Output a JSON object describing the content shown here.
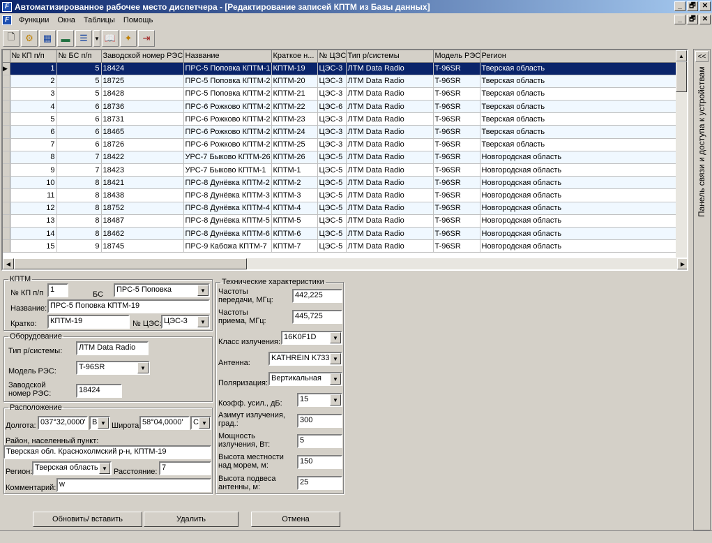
{
  "window": {
    "title": "Автоматизированное рабочее место диспетчера - [Редактирование записей КПТМ из Базы данных]",
    "icon": "app-icon"
  },
  "menu": [
    "Функции",
    "Окна",
    "Таблицы",
    "Помощь"
  ],
  "grid": {
    "columns": [
      "№ КП п/п",
      "№ БС п/п",
      "Заводской номер РЭС",
      "Название",
      "Краткое н...",
      "№ ЦЭС",
      "Тип р/системы",
      "Модель РЭС",
      "Регион"
    ],
    "rows": [
      [
        "1",
        "5",
        "18424",
        "ПРС-5 Поповка КПТМ-1",
        "КПТМ-19",
        "ЦЭС-3",
        "ЛТМ Data Radio",
        "T-96SR",
        "Тверская область"
      ],
      [
        "2",
        "5",
        "18725",
        "ПРС-5 Поповка КПТМ-2",
        "КПТМ-20",
        "ЦЭС-3",
        "ЛТМ Data Radio",
        "T-96SR",
        "Тверская область"
      ],
      [
        "3",
        "5",
        "18428",
        "ПРС-5 Поповка КПТМ-2",
        "КПТМ-21",
        "ЦЭС-3",
        "ЛТМ Data Radio",
        "T-96SR",
        "Тверская область"
      ],
      [
        "4",
        "6",
        "18736",
        "ПРС-6 Рожково КПТМ-2",
        "КПТМ-22",
        "ЦЭС-6",
        "ЛТМ Data Radio",
        "T-96SR",
        "Тверская область"
      ],
      [
        "5",
        "6",
        "18731",
        "ПРС-6 Рожково КПТМ-2",
        "КПТМ-23",
        "ЦЭС-3",
        "ЛТМ Data Radio",
        "T-96SR",
        "Тверская область"
      ],
      [
        "6",
        "6",
        "18465",
        "ПРС-6 Рожково КПТМ-2",
        "КПТМ-24",
        "ЦЭС-3",
        "ЛТМ Data Radio",
        "T-96SR",
        "Тверская область"
      ],
      [
        "7",
        "6",
        "18726",
        "ПРС-6 Рожково КПТМ-2",
        "КПТМ-25",
        "ЦЭС-3",
        "ЛТМ Data Radio",
        "T-96SR",
        "Тверская область"
      ],
      [
        "8",
        "7",
        "18422",
        "УРС-7 Быково КПТМ-26",
        "КПТМ-26",
        "ЦЭС-5",
        "ЛТМ Data Radio",
        "T-96SR",
        "Новгородская область"
      ],
      [
        "9",
        "7",
        "18423",
        "УРС-7 Быково КПТМ-1",
        "КПТМ-1",
        "ЦЭС-5",
        "ЛТМ Data Radio",
        "T-96SR",
        "Новгородская область"
      ],
      [
        "10",
        "8",
        "18421",
        "ПРС-8 Дунёвка КПТМ-2",
        "КПТМ-2",
        "ЦЭС-5",
        "ЛТМ Data Radio",
        "T-96SR",
        "Новгородская область"
      ],
      [
        "11",
        "8",
        "18438",
        "ПРС-8 Дунёвка КПТМ-3",
        "КПТМ-3",
        "ЦЭС-5",
        "ЛТМ Data Radio",
        "T-96SR",
        "Новгородская область"
      ],
      [
        "12",
        "8",
        "18752",
        "ПРС-8 Дунёвка КПТМ-4",
        "КПТМ-4",
        "ЦЭС-5",
        "ЛТМ Data Radio",
        "T-96SR",
        "Новгородская область"
      ],
      [
        "13",
        "8",
        "18487",
        "ПРС-8 Дунёвка КПТМ-5",
        "КПТМ-5",
        "ЦЭС-5",
        "ЛТМ Data Radio",
        "T-96SR",
        "Новгородская область"
      ],
      [
        "14",
        "8",
        "18462",
        "ПРС-8 Дунёвка КПТМ-6",
        "КПТМ-6",
        "ЦЭС-5",
        "ЛТМ Data Radio",
        "T-96SR",
        "Новгородская область"
      ],
      [
        "15",
        "9",
        "18745",
        "ПРС-9 Кабожа КПТМ-7",
        "КПТМ-7",
        "ЦЭС-5",
        "ЛТМ Data Radio",
        "T-96SR",
        "Новгородская область"
      ]
    ],
    "selected_row": 0
  },
  "side_panel": {
    "label": "Панель связи и доступа к устройствам",
    "collapse": "<<"
  },
  "kptm": {
    "legend": "КПТМ",
    "kp_label": "№ КП п/п",
    "kp_value": "1",
    "bs_label": "БС",
    "bs_value": "ПРС-5 Поповка",
    "name_label": "Название:",
    "name_value": "ПРС-5 Поповка КПТМ-19",
    "short_label": "Кратко:",
    "short_value": "КПТМ-19",
    "ces_label": "№ ЦЭС:",
    "ces_value": "ЦЭС-3"
  },
  "equipment": {
    "legend": "Оборудование",
    "type_label": "Тип р/системы:",
    "type_value": "ЛТМ Data Radio",
    "model_label": "Модель РЭС:",
    "model_value": "T-96SR",
    "serial_label_1": "Заводской",
    "serial_label_2": "номер РЭС:",
    "serial_value": "18424"
  },
  "location": {
    "legend": "Расположение",
    "lon_label": "Долгота:",
    "lon_value": "037°32,0000'",
    "lon_dir": "В",
    "lat_label": "Широта:",
    "lat_value": "58°04,0000'",
    "lat_dir": "С",
    "district_label": "Район, населенный пункт:",
    "district_value": "Тверская обл. Краснохолмский р-н, КПТМ-19",
    "region_label": "Регион:",
    "region_value": "Тверская область",
    "distance_label": "Расстояние:",
    "distance_value": "7",
    "comment_label": "Комментарий:",
    "comment_value": "w"
  },
  "tech": {
    "legend": "Технические характеристики",
    "tx_label_1": "Частоты",
    "tx_label_2": "передачи, МГц:",
    "tx_value": "442,225",
    "rx_label_1": "Частоты",
    "rx_label_2": "приема, МГц:",
    "rx_value": "445,725",
    "emission_label": "Класс излучения:",
    "emission_value": "16K0F1D",
    "antenna_label": "Антенна:",
    "antenna_value": "KATHREIN K733",
    "polar_label": "Поляризация:",
    "polar_value": "Вертикальная",
    "gain_label": "Коэфф. усил., дБ:",
    "gain_value": "15",
    "azimuth_label_1": "Азимут излучения,",
    "azimuth_label_2": "град.:",
    "azimuth_value": "300",
    "power_label_1": "Мощность",
    "power_label_2": "излучения, Вт:",
    "power_value": "5",
    "altitude_label_1": "Высота местности",
    "altitude_label_2": "над морем, м:",
    "altitude_value": "150",
    "mast_label_1": "Высота подвеса",
    "mast_label_2": "антенны, м:",
    "mast_value": "25"
  },
  "buttons": {
    "update": "Обновить/ вставить",
    "delete": "Удалить",
    "cancel": "Отмена"
  },
  "window_buttons": {
    "minimize": "_",
    "restore": "🗗",
    "close": "✕"
  }
}
